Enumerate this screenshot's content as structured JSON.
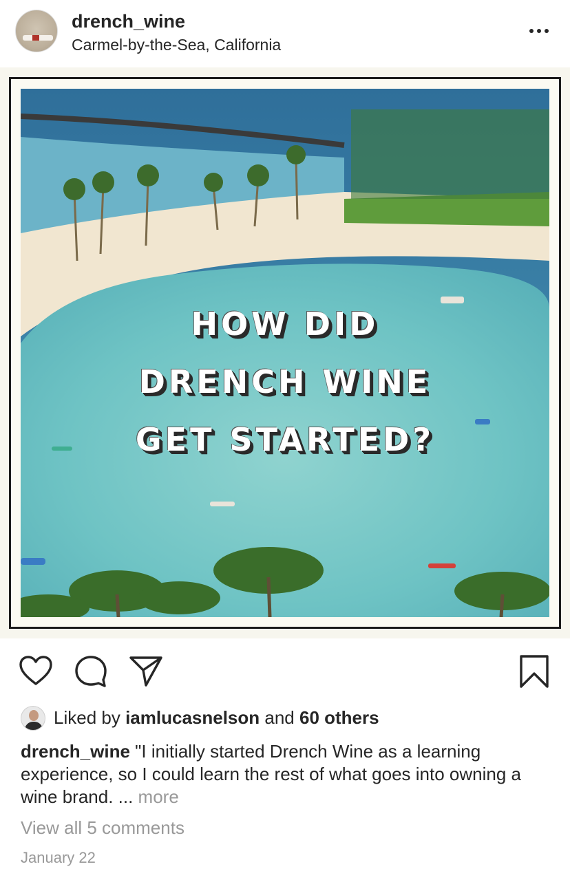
{
  "post": {
    "username": "drench_wine",
    "location": "Carmel-by-the-Sea, California",
    "image_headline": [
      "HOW DID",
      "DRENCH WINE",
      "GET STARTED?"
    ],
    "liked_by_prefix": "Liked by ",
    "liked_by_user": "iamlucasnelson",
    "liked_by_and": " and ",
    "liked_by_others": "60 others",
    "caption_user": "drench_wine",
    "caption_text": " \"I initially started Drench Wine as a learning experience, so I could learn the rest of what goes into owning a wine brand. ... ",
    "caption_more": "more",
    "view_comments": "View all 5 comments",
    "date": "January 22"
  },
  "icons": {
    "more": "more-options-icon",
    "like": "heart-icon",
    "comment": "comment-bubble-icon",
    "share": "paper-plane-icon",
    "save": "bookmark-icon"
  },
  "colors": {
    "text": "#262626",
    "muted": "#999999",
    "lagoon": "#6ec3c4",
    "sand": "#f1e6d0",
    "ocean": "#3f86a8"
  }
}
